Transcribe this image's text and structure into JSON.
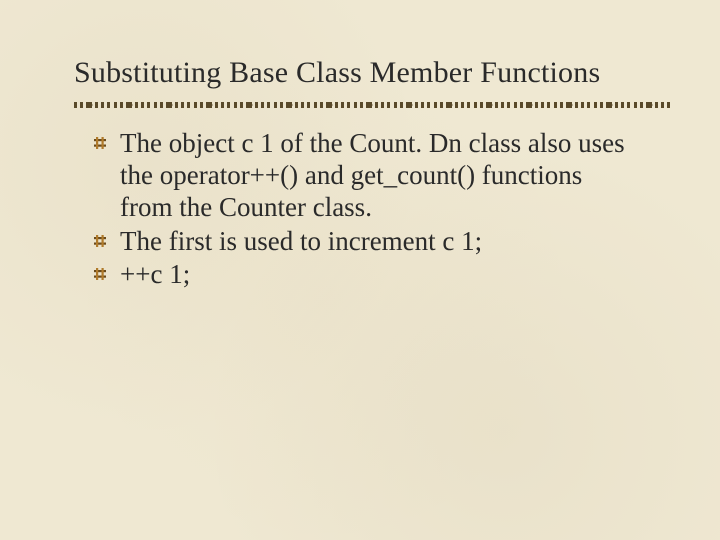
{
  "title": "Substituting Base Class Member Functions",
  "bullets": [
    "The object c 1 of the Count. Dn class also uses the operator++() and get_count() functions from the Counter class.",
    "The first is used to increment c 1;",
    "++c 1;"
  ],
  "colors": {
    "background": "#efe8d2",
    "text": "#2a2a2a",
    "accent": "#5a4a2a",
    "bullet_dark": "#6b4a1a",
    "bullet_mid": "#b07a2a",
    "bullet_light": "#d8aa4a"
  }
}
